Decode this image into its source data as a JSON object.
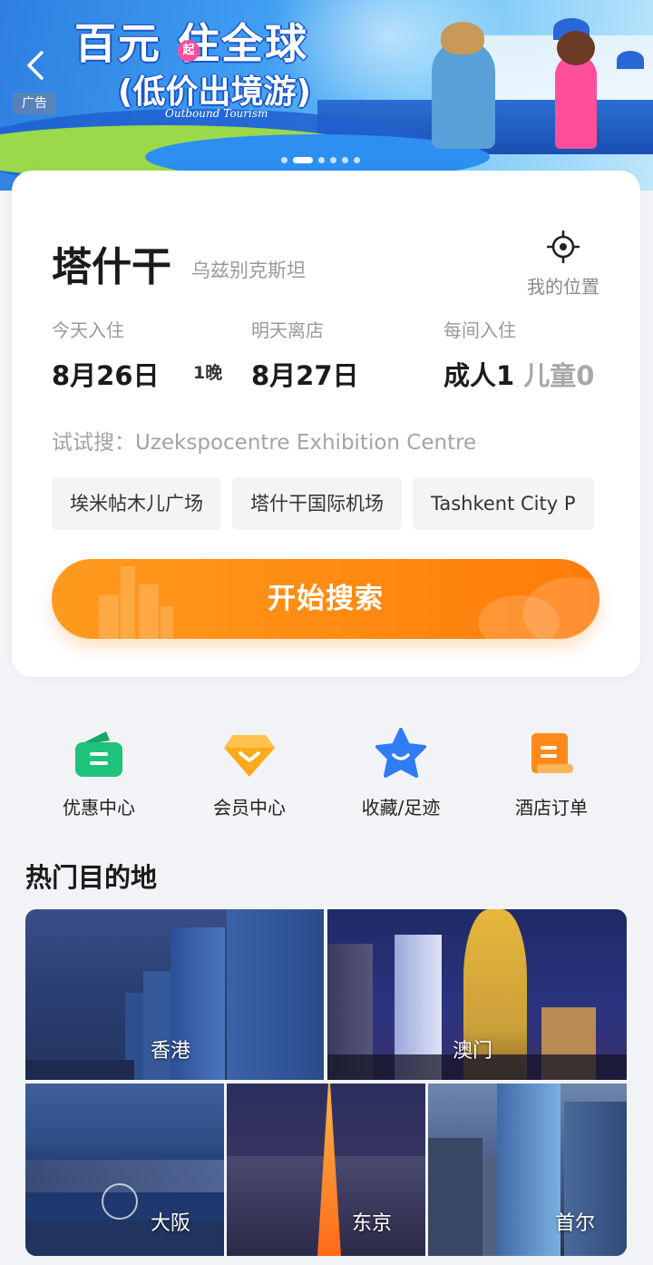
{
  "banner": {
    "title": "百元  住全球",
    "title_badge": "起",
    "subtitle": "(低价出境游)",
    "subtitle_en": "Outbound Tourism",
    "ad_label": "广告",
    "page_count": 6,
    "active_page": 1
  },
  "search": {
    "city": "塔什干",
    "country": "乌兹别克斯坦",
    "my_location_label": "我的位置",
    "checkin": {
      "caption": "今天入住",
      "date": "8月26日"
    },
    "nights": "1晚",
    "checkout": {
      "caption": "明天离店",
      "date": "8月27日"
    },
    "guests": {
      "caption": "每间入住",
      "adults": "成人1",
      "children": "儿童0"
    },
    "try_search": "试试搜：Uzekspocentre Exhibition Centre",
    "chips": [
      "埃米帖木儿广场",
      "塔什干国际机场",
      "Tashkent City P"
    ],
    "button_label": "开始搜索"
  },
  "quick_entries": [
    {
      "label": "优惠中心",
      "icon": "coupon-icon",
      "color": "#1fc27a"
    },
    {
      "label": "会员中心",
      "icon": "diamond-icon",
      "color": "#ffaa1c"
    },
    {
      "label": "收藏/足迹",
      "icon": "star-icon",
      "color": "#2f7cf6"
    },
    {
      "label": "酒店订单",
      "icon": "order-icon",
      "color": "#ff8a1a"
    }
  ],
  "hot": {
    "title": "热门目的地",
    "destinations": [
      "香港",
      "澳门",
      "大阪",
      "东京",
      "首尔"
    ]
  },
  "colors": {
    "accent_orange": "#ff8a12",
    "brand_blue": "#2e7fe0"
  }
}
